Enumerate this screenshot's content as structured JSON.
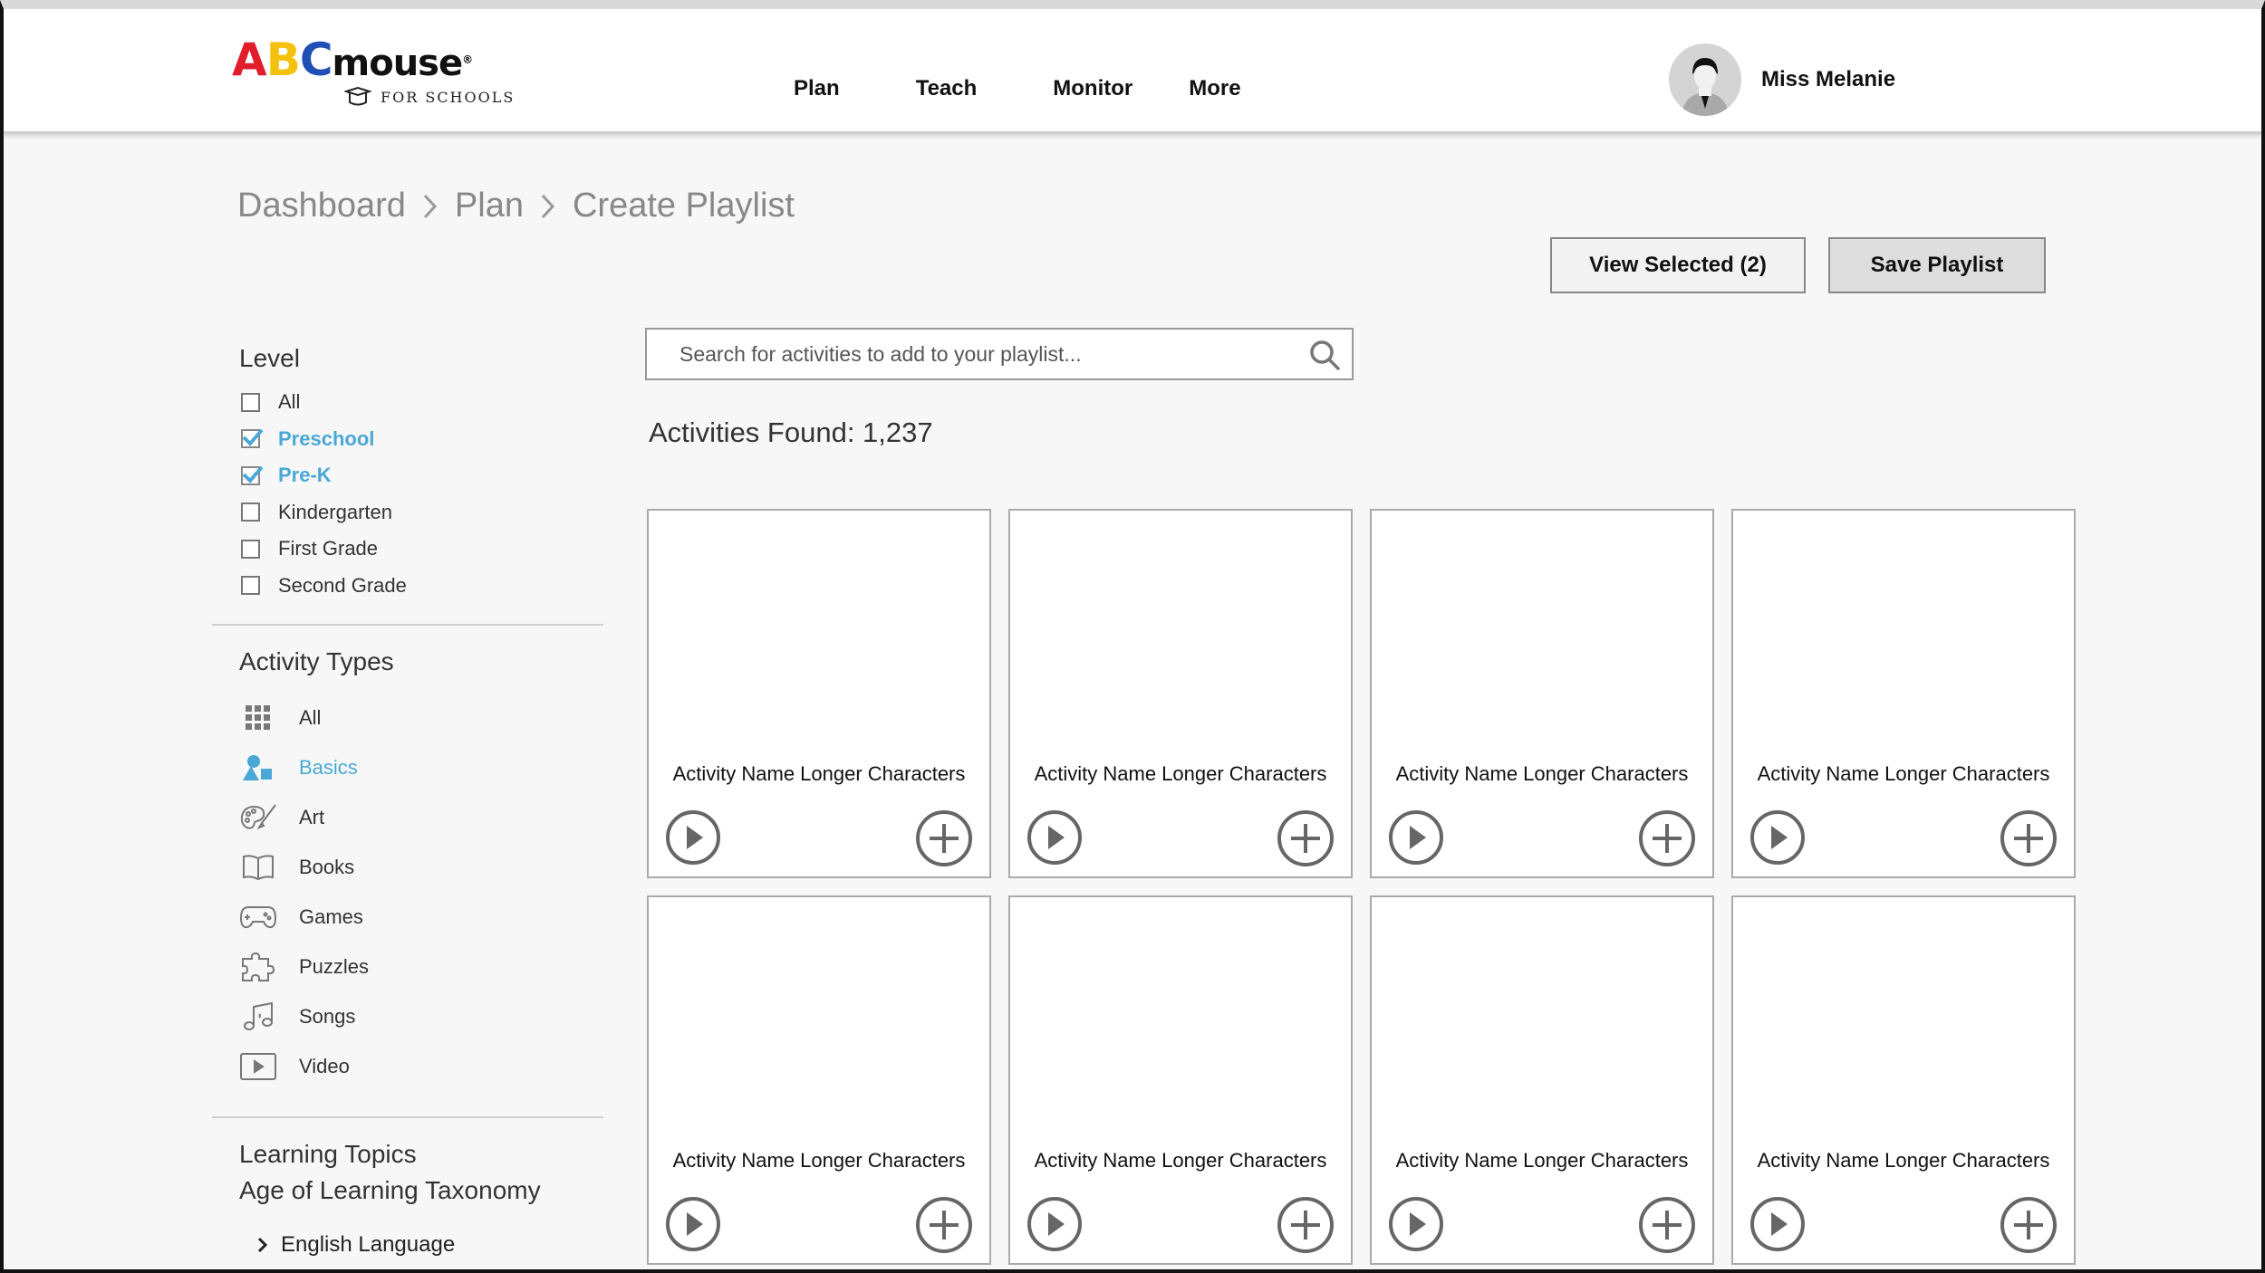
{
  "app": {
    "logo_abc": [
      "A",
      "B",
      "C"
    ],
    "logo_mouse": "mouse",
    "logo_reg": "®",
    "logo_sub": "FOR SCHOOLS"
  },
  "nav": {
    "items": [
      "Plan",
      "Teach",
      "Monitor",
      "More"
    ]
  },
  "user": {
    "name": "Miss Melanie"
  },
  "breadcrumb": [
    "Dashboard",
    "Plan",
    "Create Playlist"
  ],
  "actions": {
    "view_selected": "View Selected (2)",
    "save_playlist": "Save Playlist"
  },
  "search": {
    "placeholder": "Search for activities to add to your playlist..."
  },
  "results": {
    "found_label": "Activities Found: 1,237"
  },
  "filters": {
    "level_title": "Level",
    "levels": [
      {
        "label": "All",
        "checked": false
      },
      {
        "label": "Preschool",
        "checked": true
      },
      {
        "label": "Pre-K",
        "checked": true
      },
      {
        "label": "Kindergarten",
        "checked": false
      },
      {
        "label": "First Grade",
        "checked": false
      },
      {
        "label": "Second Grade",
        "checked": false
      }
    ],
    "types_title": "Activity Types",
    "types": [
      {
        "label": "All",
        "icon": "grid-icon"
      },
      {
        "label": "Basics",
        "icon": "basics-icon",
        "active": true
      },
      {
        "label": "Art",
        "icon": "palette-icon"
      },
      {
        "label": "Books",
        "icon": "book-icon"
      },
      {
        "label": "Games",
        "icon": "gamepad-icon"
      },
      {
        "label": "Puzzles",
        "icon": "puzzle-icon"
      },
      {
        "label": "Songs",
        "icon": "music-note-icon"
      },
      {
        "label": "Video",
        "icon": "video-icon"
      }
    ],
    "topics_title": "Learning Topics",
    "taxonomy": "Age of Learning Taxonomy",
    "tree_first": "English Language"
  },
  "cards": [
    {
      "title": "Activity Name Longer Characters"
    },
    {
      "title": "Activity Name Longer Characters"
    },
    {
      "title": "Activity Name Longer Characters"
    },
    {
      "title": "Activity Name Longer Characters"
    },
    {
      "title": "Activity Name Longer Characters"
    },
    {
      "title": "Activity Name Longer Characters"
    },
    {
      "title": "Activity Name Longer Characters"
    },
    {
      "title": "Activity Name Longer Characters"
    }
  ],
  "colors": {
    "accent": "#4aa8d8",
    "logo_red": "#e21d2b",
    "logo_yellow": "#f4c20d",
    "logo_blue": "#1f4fb5"
  }
}
